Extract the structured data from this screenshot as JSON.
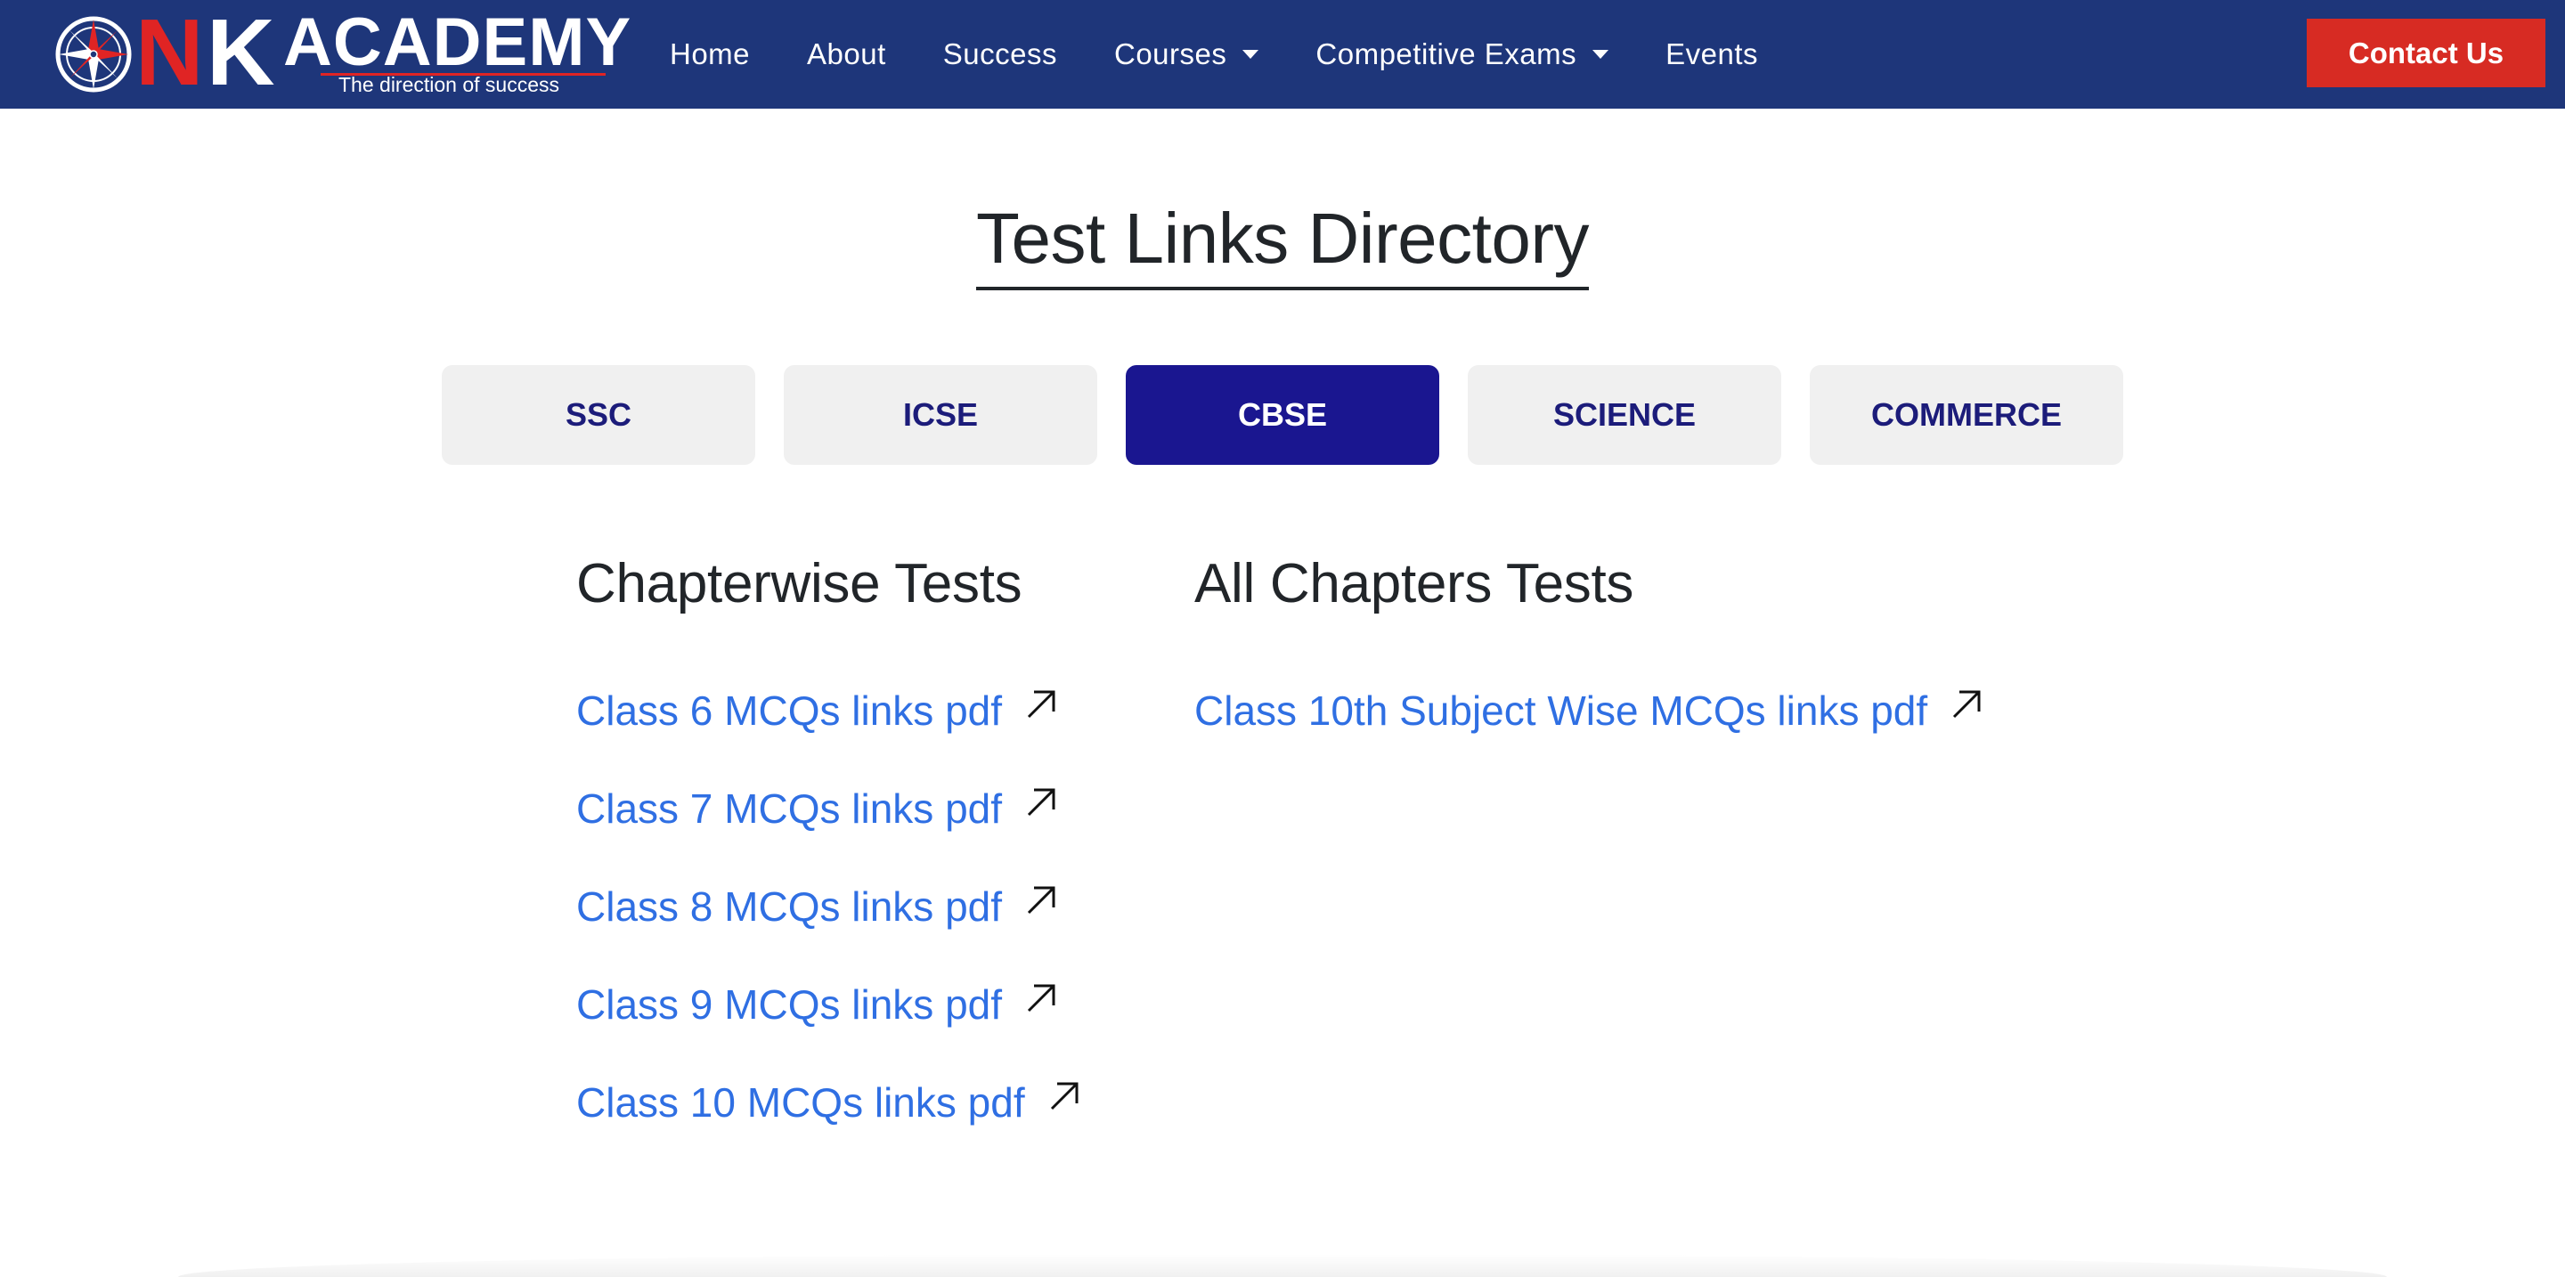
{
  "brand": {
    "letter_n": "N",
    "letter_k": "K",
    "name": "ACADEMY",
    "tagline": "The direction of success",
    "colors": {
      "navbar": "#1e367a",
      "accent_red": "#d72b23",
      "logo_red": "#e02424"
    }
  },
  "nav": {
    "items": [
      {
        "label": "Home",
        "dropdown": false
      },
      {
        "label": "About",
        "dropdown": false
      },
      {
        "label": "Success",
        "dropdown": false
      },
      {
        "label": "Courses",
        "dropdown": true
      },
      {
        "label": "Competitive Exams",
        "dropdown": true
      },
      {
        "label": "Events",
        "dropdown": false
      }
    ],
    "contact_label": "Contact Us"
  },
  "main": {
    "title": "Test Links Directory",
    "tabs": [
      {
        "label": "SSC",
        "active": false
      },
      {
        "label": "ICSE",
        "active": false
      },
      {
        "label": "CBSE",
        "active": true
      },
      {
        "label": "SCIENCE",
        "active": false
      },
      {
        "label": "COMMERCE",
        "active": false
      }
    ],
    "active_tab_color": "#1a1690",
    "link_color": "#2f6fe3",
    "chapterwise": {
      "heading": "Chapterwise Tests",
      "links": [
        "Class 6 MCQs links pdf",
        "Class 7 MCQs links pdf",
        "Class 8 MCQs links pdf",
        "Class 9 MCQs links pdf",
        "Class 10 MCQs links pdf"
      ]
    },
    "all_chapters": {
      "heading": "All Chapters Tests",
      "links": [
        "Class 10th Subject Wise MCQs links pdf"
      ]
    }
  },
  "icons": {
    "logo": "compass-icon",
    "dropdown": "caret-down-icon",
    "external_link": "arrow-up-right-icon"
  }
}
